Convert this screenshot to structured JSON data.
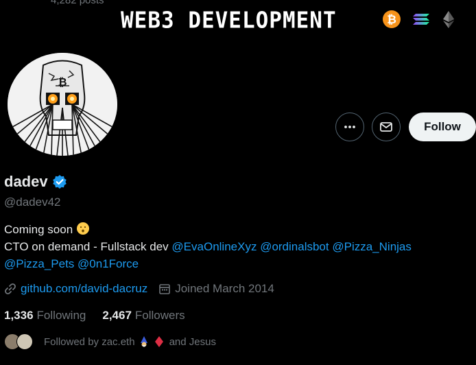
{
  "header": {
    "posts_count": "4,282 posts",
    "banner_title": "WEB3 DEVELOPMENT",
    "banner_icons": [
      "bitcoin-icon",
      "solana-icon",
      "ethereum-icon"
    ]
  },
  "actions": {
    "more_label": "More",
    "message_label": "Message",
    "follow_label": "Follow"
  },
  "profile": {
    "display_name": "dadev",
    "handle": "@dadev42",
    "verified": true,
    "bio_line1": "Coming soon",
    "bio_line2_prefix": "CTO on demand - Fullstack dev",
    "mentions": [
      "@EvaOnlineXyz",
      "@ordinalsbot",
      "@Pizza_Ninjas",
      "@Pizza_Pets",
      "@0n1Force"
    ],
    "website": "github.com/david-dacruz",
    "joined": "Joined March 2014"
  },
  "stats": {
    "following_count": "1,336",
    "following_label": "Following",
    "followers_count": "2,467",
    "followers_label": "Followers"
  },
  "followed_by": {
    "prefix": "Followed by zac.eth",
    "suffix": "and Jesus"
  },
  "colors": {
    "background": "#000000",
    "link": "#1d9bf0",
    "muted": "#71767b",
    "text": "#e7e9ea",
    "follow_bg": "#eff3f4",
    "bitcoin": "#f7931a",
    "verified": "#1d9bf0"
  }
}
